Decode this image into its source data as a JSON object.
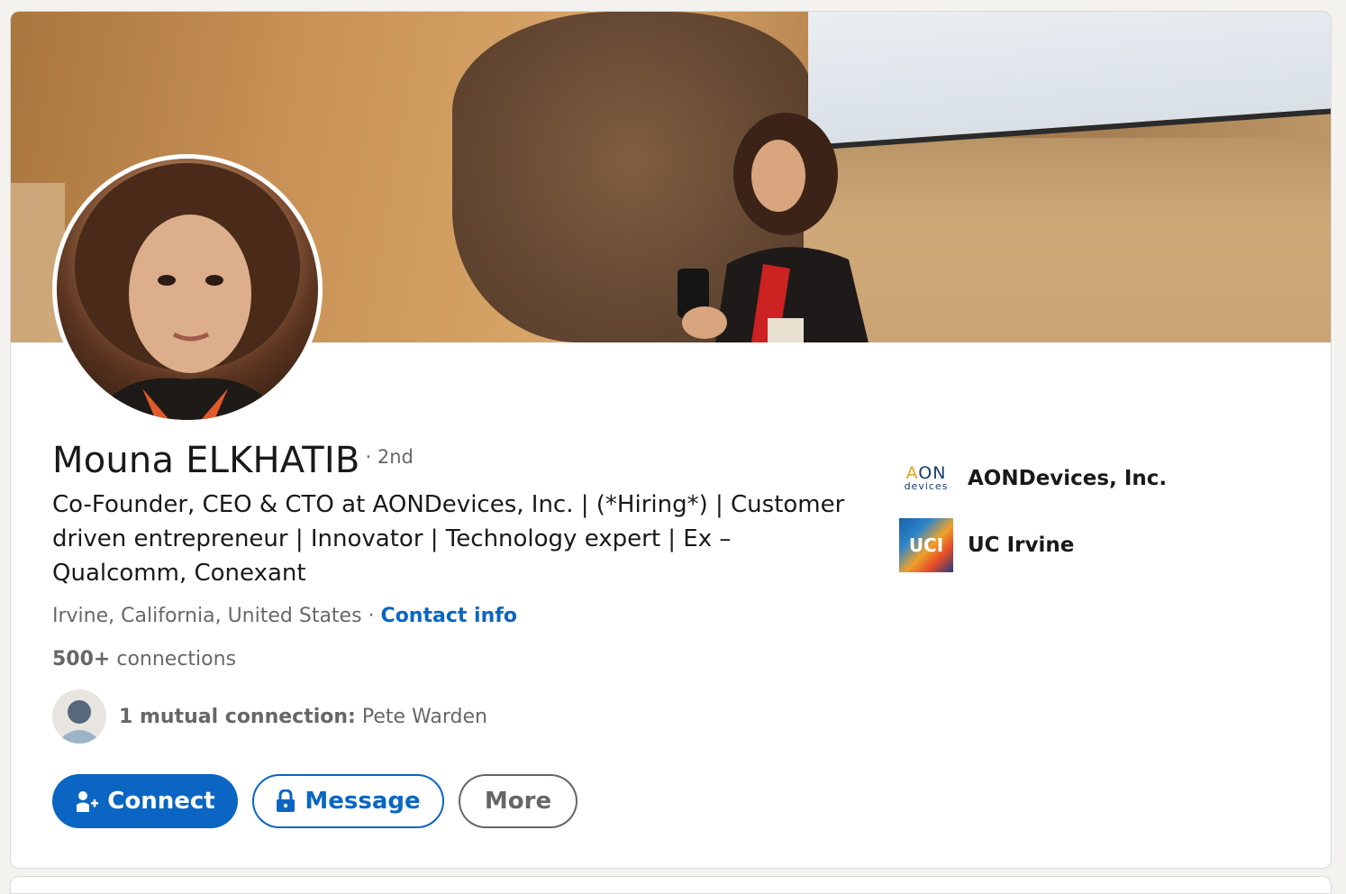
{
  "profile": {
    "name": "Mouna ELKHATIB",
    "degree": "· 2nd",
    "headline": "Co-Founder, CEO & CTO at AONDevices, Inc. | (*Hiring*) | Customer driven entrepreneur | Innovator | Technology expert | Ex – Qualcomm, Conexant",
    "location": "Irvine, California, United States",
    "separator": " · ",
    "contact_info_label": "Contact info",
    "connections_count": "500+",
    "connections_label": " connections",
    "mutual_bold": "1 mutual connection:",
    "mutual_name": " Pete Warden"
  },
  "actions": {
    "connect_label": "Connect",
    "message_label": "Message",
    "more_label": "More"
  },
  "side": {
    "company": {
      "logo_top_a": "A",
      "logo_top_rest": "ON",
      "logo_bottom": "devices",
      "label": "AONDevices, Inc."
    },
    "school": {
      "logo_text": "UCI",
      "label": "UC Irvine"
    }
  },
  "colors": {
    "accent": "#0a66c2",
    "page_bg": "#f3f2ef"
  }
}
